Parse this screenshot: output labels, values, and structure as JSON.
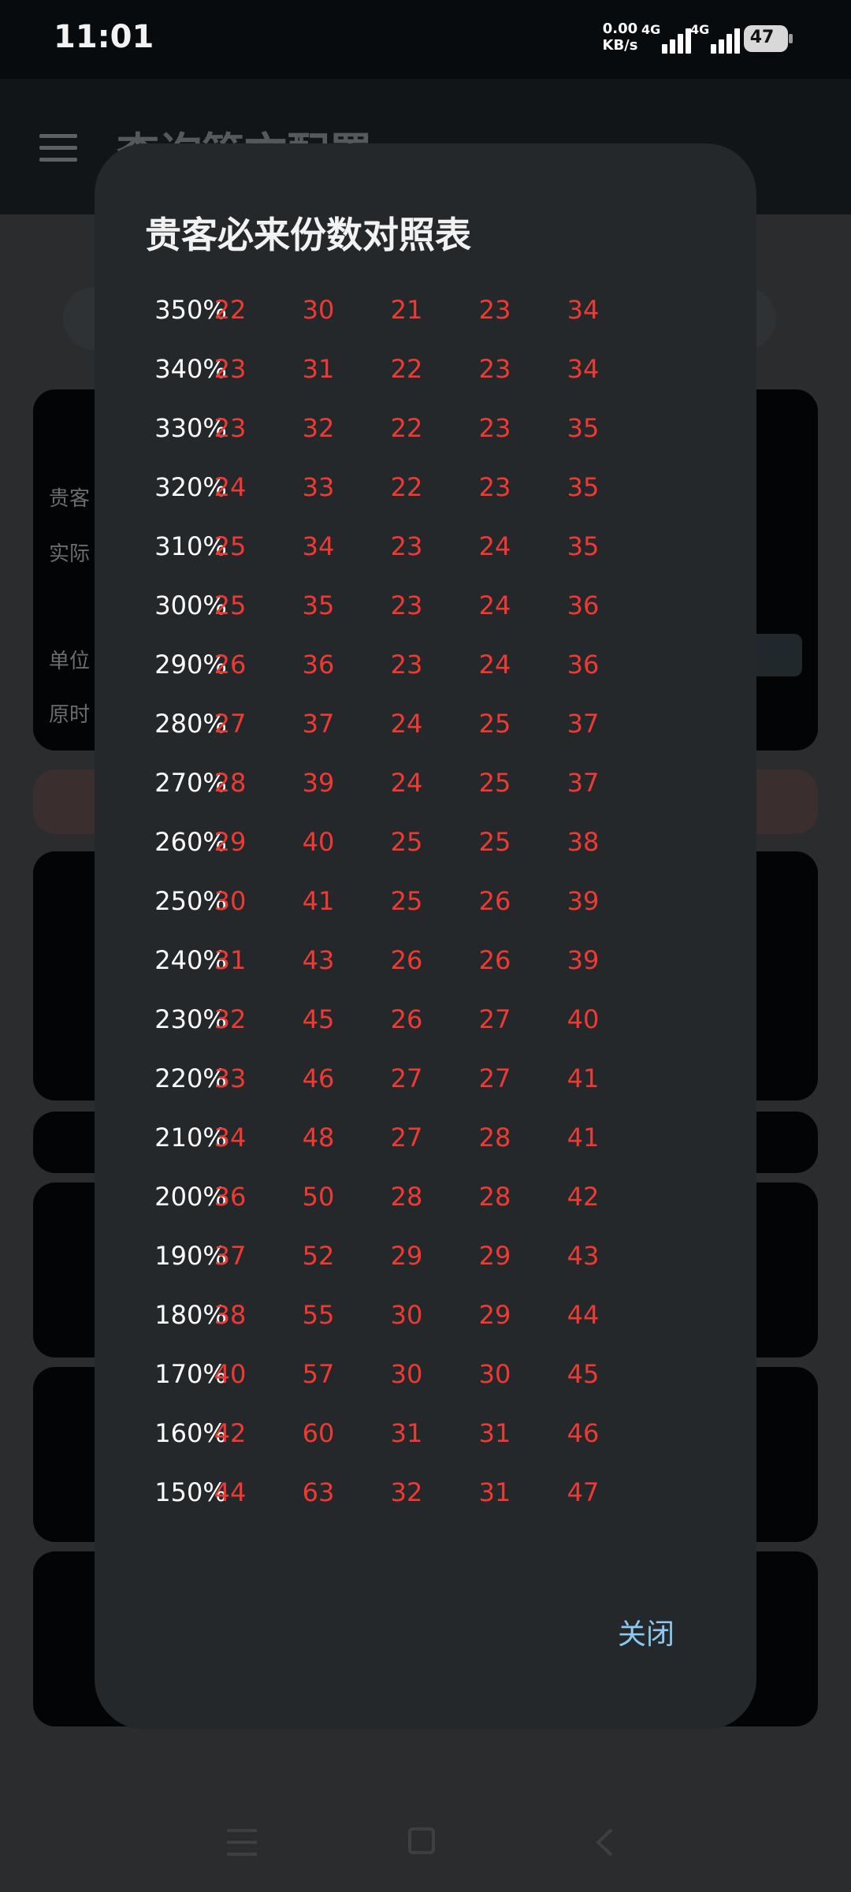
{
  "status_bar": {
    "time": "11:01",
    "net_speed_value": "0.00",
    "net_speed_unit": "KB/s",
    "sim1_label": "4G",
    "sim2_label": "4G",
    "battery": "47"
  },
  "app_bar": {
    "title": "查询管文配置"
  },
  "background": {
    "labels": [
      "贵客",
      "实际",
      "单位",
      "原时"
    ]
  },
  "dialog": {
    "title": "贵客必来份数对照表",
    "rows": [
      {
        "pct": "350%",
        "values": [
          "22",
          "30",
          "21",
          "23",
          "34"
        ]
      },
      {
        "pct": "340%",
        "values": [
          "23",
          "31",
          "22",
          "23",
          "34"
        ]
      },
      {
        "pct": "330%",
        "values": [
          "23",
          "32",
          "22",
          "23",
          "35"
        ]
      },
      {
        "pct": "320%",
        "values": [
          "24",
          "33",
          "22",
          "23",
          "35"
        ]
      },
      {
        "pct": "310%",
        "values": [
          "25",
          "34",
          "23",
          "24",
          "35"
        ]
      },
      {
        "pct": "300%",
        "values": [
          "25",
          "35",
          "23",
          "24",
          "36"
        ]
      },
      {
        "pct": "290%",
        "values": [
          "26",
          "36",
          "23",
          "24",
          "36"
        ]
      },
      {
        "pct": "280%",
        "values": [
          "27",
          "37",
          "24",
          "25",
          "37"
        ]
      },
      {
        "pct": "270%",
        "values": [
          "28",
          "39",
          "24",
          "25",
          "37"
        ]
      },
      {
        "pct": "260%",
        "values": [
          "29",
          "40",
          "25",
          "25",
          "38"
        ]
      },
      {
        "pct": "250%",
        "values": [
          "30",
          "41",
          "25",
          "26",
          "39"
        ]
      },
      {
        "pct": "240%",
        "values": [
          "31",
          "43",
          "26",
          "26",
          "39"
        ]
      },
      {
        "pct": "230%",
        "values": [
          "32",
          "45",
          "26",
          "27",
          "40"
        ]
      },
      {
        "pct": "220%",
        "values": [
          "33",
          "46",
          "27",
          "27",
          "41"
        ]
      },
      {
        "pct": "210%",
        "values": [
          "34",
          "48",
          "27",
          "28",
          "41"
        ]
      },
      {
        "pct": "200%",
        "values": [
          "36",
          "50",
          "28",
          "28",
          "42"
        ]
      },
      {
        "pct": "190%",
        "values": [
          "37",
          "52",
          "29",
          "29",
          "43"
        ]
      },
      {
        "pct": "180%",
        "values": [
          "38",
          "55",
          "30",
          "29",
          "44"
        ]
      },
      {
        "pct": "170%",
        "values": [
          "40",
          "57",
          "30",
          "30",
          "45"
        ]
      },
      {
        "pct": "160%",
        "values": [
          "42",
          "60",
          "31",
          "31",
          "46"
        ]
      },
      {
        "pct": "150%",
        "values": [
          "44",
          "63",
          "32",
          "31",
          "47"
        ]
      }
    ],
    "close_label": "关闭"
  },
  "colors": {
    "dialog_bg": "#25282b",
    "value_red": "#ee3a33",
    "close_blue": "#8cc8ef"
  }
}
